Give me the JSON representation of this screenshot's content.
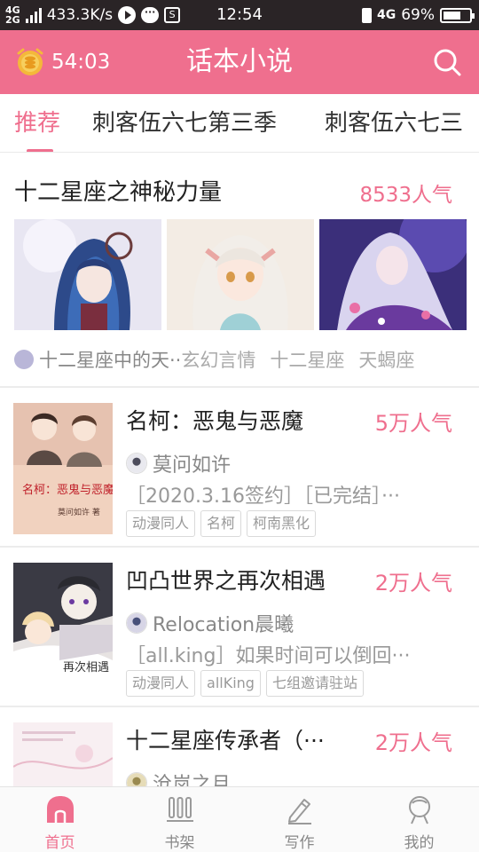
{
  "status_bar": {
    "network_top": "4G",
    "network_bottom": "2G",
    "speed": "433.3K/s",
    "chat_glyph": "···",
    "box_glyph": "S",
    "time": "12:54",
    "net_type": "4G",
    "battery_text": "69%",
    "battery_level": 0.69
  },
  "header": {
    "timer": "54:03",
    "title": "话本小说",
    "alarm_icon": "alarm-coin-icon",
    "search_icon": "search-icon"
  },
  "tabs": [
    {
      "label": "推荐",
      "active": true
    },
    {
      "label": "刺客伍六七第三季",
      "active": false
    },
    {
      "label": "刺客伍六七三",
      "active": false
    }
  ],
  "featured": {
    "title": "十二星座之神秘力量",
    "popularity": "8533人气",
    "first_tag": "十二星座中的天··",
    "tags": [
      "玄幻言情",
      "十二星座",
      "天蝎座"
    ]
  },
  "books": [
    {
      "title": "名柯：恶鬼与恶魔",
      "popularity": "5万人气",
      "author": "莫问如许",
      "description": "［2020.3.16签约］［已完结］···",
      "tags": [
        "动漫同人",
        "名柯",
        "柯南黑化"
      ],
      "cover_text": "名柯：恶鬼与恶魔",
      "cover_small": "莫问如许 著"
    },
    {
      "title": "凹凸世界之再次相遇",
      "popularity": "2万人气",
      "author": "Relocation晨曦",
      "description": "［all.king］如果时间可以倒回···",
      "tags": [
        "动漫同人",
        "allKing",
        "七组邀请驻站"
      ],
      "cover_text": "再次相遇"
    },
    {
      "title": "十二星座传承者（···",
      "popularity": "2万人气",
      "author": "沧岚之月"
    }
  ],
  "bottom_nav": [
    {
      "label": "首页",
      "icon": "home-icon",
      "active": true
    },
    {
      "label": "书架",
      "icon": "bookshelf-icon",
      "active": false
    },
    {
      "label": "写作",
      "icon": "pen-icon",
      "active": false
    },
    {
      "label": "我的",
      "icon": "profile-icon",
      "active": false
    }
  ],
  "colors": {
    "accent": "#ef6f8e",
    "statusbar": "#2a2426"
  }
}
